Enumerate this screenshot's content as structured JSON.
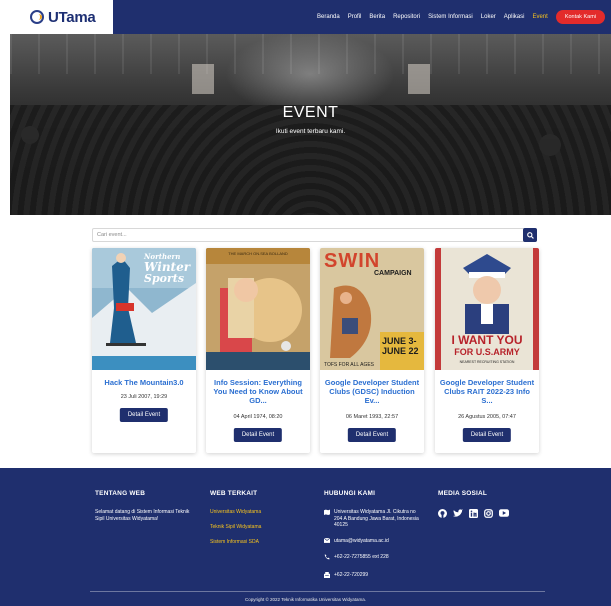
{
  "nav": {
    "brand": "UTama",
    "items": [
      "Beranda",
      "Profil",
      "Berita",
      "Repositori",
      "Sistem Informasi",
      "Loker",
      "Aplikasi",
      "Event"
    ],
    "active": "Event",
    "cta": "Kontak Kami"
  },
  "hero": {
    "title": "EVENT",
    "subtitle": "Ikuti event terbaru kami."
  },
  "search": {
    "placeholder": "Cari event..."
  },
  "events": [
    {
      "title": "Hack The Mountain3.0",
      "date": "23 Juli 2007, 19:29",
      "button": "Detail Event"
    },
    {
      "title": "Info Session: Everything You Need to Know About GD...",
      "date": "04 April 1974, 08:20",
      "button": "Detail Event"
    },
    {
      "title": "Google Developer Student Clubs (GDSC) Induction Ev...",
      "date": "06 Maret 1993, 22:57",
      "button": "Detail Event"
    },
    {
      "title": "Google Developer Student Clubs RAIT 2022-23 Info S...",
      "date": "26 Agustus 2005, 07:47",
      "button": "Detail Event"
    }
  ],
  "posters": {
    "p1": {
      "line1": "Northern",
      "line2": "Winter",
      "line3": "Sports"
    },
    "p2": {
      "top": "THE MARCH ON.SEA BOLLAND"
    },
    "p3": {
      "line1": "SWIN",
      "line2": "CAMPAIGN",
      "line3": "JUNE 3-",
      "line4": "JUNE 22",
      "line5": "TOFS FOR ALL AGES"
    },
    "p4": {
      "line1": "I WANT YOU",
      "line2": "FOR U.S.ARMY",
      "line3": "NEAREST RECRUITING STATION"
    }
  },
  "footer": {
    "about_title": "TENTANG WEB",
    "about_text": "Selamat datang di Sistem Informasi Teknik Sipil Universitas Widyatama!",
    "links_title": "WEB TERKAIT",
    "links": [
      "Universitas Widyatama",
      "Teknik Sipil Widyatama",
      "Sistem Informasi SDA"
    ],
    "contact_title": "HUBUNGI KAMI",
    "address": "Universitas Widyatama Jl. Cikutra no 204 A Bandung Jawa Barat, Indonesia 40125",
    "email": "utama@widyatama.ac.id",
    "phone": "+62-22-7275855 ext 228",
    "fax": "+62-22-720299",
    "social_title": "MEDIA SOSIAL",
    "copyright": "Copyright © 2022 Teknik Informatika Universitas Widyatama."
  },
  "colors": {
    "navy": "#1f2f6e",
    "accent": "#f7c31d",
    "cta": "#e32b2b",
    "link": "#2b6fd1"
  },
  "icons": [
    "search-icon",
    "map-icon",
    "email-icon",
    "phone-icon",
    "fax-icon",
    "github-icon",
    "twitter-icon",
    "linkedin-icon",
    "instagram-icon",
    "youtube-icon"
  ]
}
